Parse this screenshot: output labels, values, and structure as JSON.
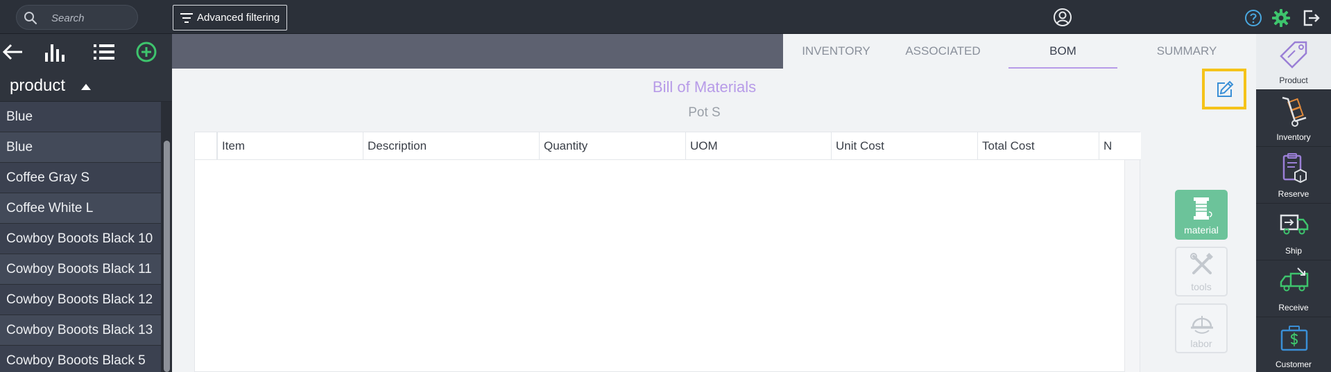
{
  "topbar": {
    "search_placeholder": "Search",
    "advanced_filtering_label": "Advanced filtering"
  },
  "left_panel": {
    "section_title": "product",
    "items": [
      "Blue",
      "Blue",
      "Coffee Gray S",
      "Coffee White L",
      "Cowboy Booots Black 10",
      "Cowboy Booots Black 11",
      "Cowboy Booots Black 12",
      "Cowboy Booots Black 13",
      "Cowboy Booots Black 5"
    ]
  },
  "tabs": [
    {
      "label": "INVENTORY",
      "active": false
    },
    {
      "label": "ASSOCIATED",
      "active": false
    },
    {
      "label": "BOM",
      "active": true
    },
    {
      "label": "SUMMARY",
      "active": false
    }
  ],
  "bom": {
    "title": "Bill of Materials",
    "subtitle": "Pot S",
    "columns": [
      "Item",
      "Description",
      "Quantity",
      "UOM",
      "Unit Cost",
      "Total Cost",
      "N"
    ]
  },
  "side_buttons": [
    {
      "label": "material",
      "icon": "spool-icon",
      "active": true
    },
    {
      "label": "tools",
      "icon": "tools-icon",
      "active": false
    },
    {
      "label": "labor",
      "icon": "hardhat-icon",
      "active": false
    }
  ],
  "right_nav": [
    {
      "label": "Product",
      "icon": "price-tag-icon"
    },
    {
      "label": "Inventory",
      "icon": "hand-truck-icon"
    },
    {
      "label": "Reserve",
      "icon": "clipboard-box-icon"
    },
    {
      "label": "Ship",
      "icon": "truck-out-icon"
    },
    {
      "label": "Receive",
      "icon": "truck-in-icon"
    },
    {
      "label": "Customer",
      "icon": "briefcase-dollar-icon"
    }
  ],
  "colors": {
    "accent_purple": "#b79be8",
    "active_green": "#6cc39a",
    "highlight_yellow": "#f5c31a",
    "dark_bg": "#2f343d"
  }
}
